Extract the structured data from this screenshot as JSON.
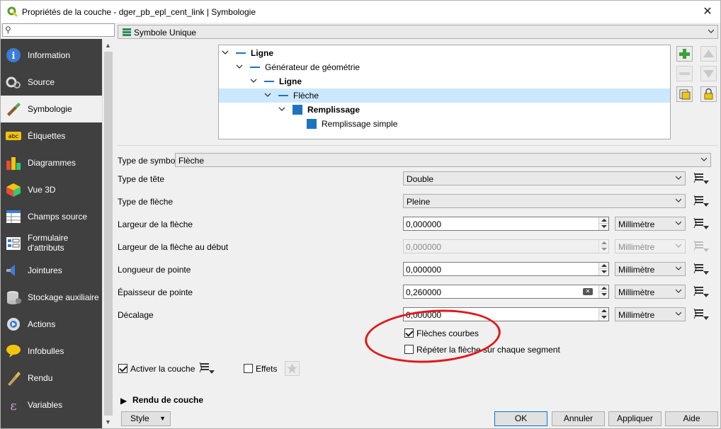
{
  "window": {
    "title": "Propriétés de la couche - dger_pb_epl_cent_link | Symbologie"
  },
  "sidebar": {
    "items": [
      {
        "label": "Information",
        "icon": "information-icon"
      },
      {
        "label": "Source",
        "icon": "source-icon"
      },
      {
        "label": "Symbologie",
        "icon": "symbology-icon",
        "selected": true
      },
      {
        "label": "Étiquettes",
        "icon": "labels-icon"
      },
      {
        "label": "Diagrammes",
        "icon": "diagrams-icon"
      },
      {
        "label": "Vue 3D",
        "icon": "view3d-icon"
      },
      {
        "label": "Champs source",
        "icon": "source-fields-icon"
      },
      {
        "label": "Formulaire d'attributs",
        "icon": "attributes-form-icon"
      },
      {
        "label": "Jointures",
        "icon": "joins-icon"
      },
      {
        "label": "Stockage auxiliaire",
        "icon": "auxiliary-storage-icon"
      },
      {
        "label": "Actions",
        "icon": "actions-icon"
      },
      {
        "label": "Infobulles",
        "icon": "tooltips-icon"
      },
      {
        "label": "Rendu",
        "icon": "rendering-icon"
      },
      {
        "label": "Variables",
        "icon": "variables-icon"
      }
    ]
  },
  "renderer": {
    "value": "Symbole Unique"
  },
  "tree": [
    {
      "label": "Ligne",
      "bold": true,
      "kind": "line",
      "level": 0
    },
    {
      "label": "Générateur de géométrie",
      "bold": false,
      "kind": "line",
      "level": 1
    },
    {
      "label": "Ligne",
      "bold": true,
      "kind": "line",
      "level": 2
    },
    {
      "label": "Flèche",
      "bold": false,
      "kind": "line",
      "level": 3,
      "selected": true
    },
    {
      "label": "Remplissage",
      "bold": true,
      "kind": "fill",
      "level": 4
    },
    {
      "label": "Remplissage simple",
      "bold": false,
      "kind": "fill",
      "level": 5
    }
  ],
  "symbol_type": {
    "label": "Type de symbole",
    "value": "Flèche"
  },
  "props": {
    "head_type": {
      "label": "Type de tête",
      "value": "Double"
    },
    "arrow_type": {
      "label": "Type de flèche",
      "value": "Pleine"
    },
    "arrow_width": {
      "label": "Largeur de la flèche",
      "value": "0,000000",
      "unit": "Millimètre"
    },
    "arrow_start_width": {
      "label": "Largeur de la flèche au début",
      "value": "0,000000",
      "unit": "Millimètre",
      "disabled": true
    },
    "head_length": {
      "label": "Longueur de pointe",
      "value": "0,000000",
      "unit": "Millimètre"
    },
    "head_thickness": {
      "label": "Épaisseur de pointe",
      "value": "0,260000",
      "unit": "Millimètre"
    },
    "offset": {
      "label": "Décalage",
      "value": "0,000000",
      "unit": "Millimètre"
    }
  },
  "checks": {
    "curved": {
      "label": "Flèches courbes",
      "checked": true
    },
    "repeat": {
      "label": "Répéter la flèche sur chaque segment",
      "checked": false
    },
    "enable_layer": {
      "label": "Activer la couche",
      "checked": true
    },
    "effects": {
      "label": "Effets",
      "checked": false
    }
  },
  "layer_render": {
    "label": "Rendu de couche"
  },
  "footer": {
    "style": "Style",
    "ok": "OK",
    "cancel": "Annuler",
    "apply": "Appliquer",
    "help": "Aide"
  },
  "colors": {
    "accent": "#1e73be",
    "selection": "#cce8ff",
    "sidebar": "#404040",
    "annotation": "#e01818"
  }
}
